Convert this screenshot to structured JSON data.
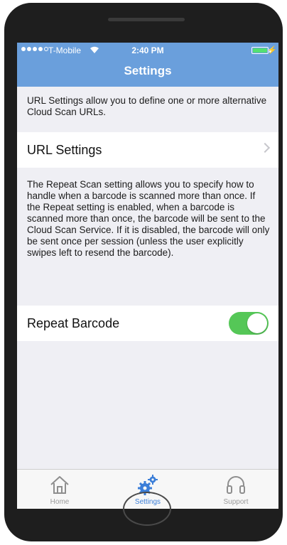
{
  "status_bar": {
    "carrier": "T-Mobile",
    "time": "2:40 PM",
    "signal_bars_filled": 4,
    "signal_bars_total": 5
  },
  "nav": {
    "title": "Settings"
  },
  "sections": {
    "url_description": "URL Settings allow you to define one or more alternative Cloud Scan URLs.",
    "url_row_label": "URL Settings",
    "repeat_description": "The Repeat Scan setting allows you to specify how to handle when a barcode is scanned more than once. If the Repeat setting is enabled, when a barcode is scanned more than once, the barcode will be sent to the Cloud Scan Service. If it is disabled, the barcode will only be sent once per session (unless the user explicitly swipes left to resend the barcode).",
    "repeat_row_label": "Repeat Barcode",
    "repeat_enabled": true
  },
  "tabbar": {
    "items": [
      {
        "label": "Home",
        "icon": "home-icon",
        "active": false
      },
      {
        "label": "Settings",
        "icon": "gears-icon",
        "active": true
      },
      {
        "label": "Support",
        "icon": "headset-icon",
        "active": false
      }
    ]
  },
  "colors": {
    "nav_bar": "#6a9fdc",
    "toggle_on": "#55c757",
    "active_tab": "#3b7ed8",
    "inactive_tab": "#9a9a9a",
    "background": "#efeff4"
  }
}
